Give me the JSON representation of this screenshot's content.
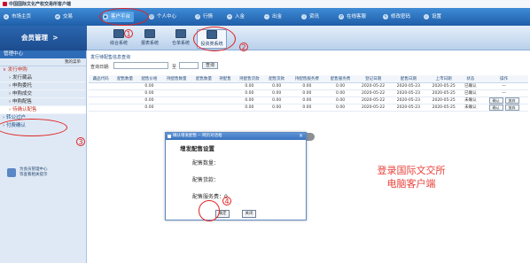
{
  "window": {
    "title": "中国国际文化产权交易所客户端"
  },
  "nav": {
    "items": [
      {
        "label": "市场主页",
        "icon": "home-icon"
      },
      {
        "label": "交易",
        "icon": "trade-icon"
      },
      {
        "label": "客户平台",
        "icon": "platform-icon",
        "active": true
      },
      {
        "label": "个人中心",
        "icon": "user-icon"
      },
      {
        "label": "行情",
        "icon": "market-icon"
      },
      {
        "label": "入金",
        "icon": "deposit-icon"
      },
      {
        "label": "出金",
        "icon": "withdraw-icon"
      },
      {
        "label": "资讯",
        "icon": "info-icon"
      },
      {
        "label": "在线客服",
        "icon": "service-icon"
      },
      {
        "label": "修改密码",
        "icon": "password-icon"
      },
      {
        "label": "设置",
        "icon": "settings-icon"
      }
    ]
  },
  "subheader": {
    "member_title": "会员管理",
    "systems": [
      {
        "label": "综合系统"
      },
      {
        "label": "报表系统"
      },
      {
        "label": "仓单系统"
      },
      {
        "label": "投资类系统",
        "active": true
      }
    ]
  },
  "sidebar": {
    "header": "管理中心",
    "sub": "我的菜单",
    "categories": [
      {
        "label": "发行申购",
        "items": [
          "发行藏品",
          "申购委托",
          "申购成交",
          "申购配售",
          "待确认配售"
        ]
      },
      {
        "label": "转公过户",
        "items": []
      },
      {
        "label": "付费确认",
        "items": []
      }
    ],
    "footer_line1": "为会员管理中心",
    "footer_line2": "等查看相关提示"
  },
  "main": {
    "breadcrumb": "发行待配售信息查询",
    "filter_label": "查询日期:",
    "to_label": "至",
    "query_button": "查询",
    "columns": [
      "藏品代码",
      "配售数量",
      "配售价格",
      "持配售数量",
      "配售数量",
      "持配售",
      "持配售货款",
      "配售货款",
      "持配售服务费",
      "配售服务费",
      "登记日期",
      "配售日期",
      "上市日期",
      "状态",
      "操作"
    ],
    "rows": [
      [
        "",
        "",
        "0.00",
        "",
        "",
        "",
        "0.00",
        "0.00",
        "0.00",
        "0.00",
        "2020-05-22",
        "2020-05-23",
        "2020-05-25",
        "已确认",
        "—"
      ],
      [
        "",
        "",
        "0.00",
        "",
        "",
        "",
        "0.00",
        "0.00",
        "0.00",
        "0.00",
        "2020-05-22",
        "2020-05-23",
        "2020-05-25",
        "已确认",
        "—"
      ],
      [
        "",
        "",
        "0.00",
        "",
        "",
        "",
        "0.00",
        "0.00",
        "0.00",
        "0.00",
        "2020-05-22",
        "2020-05-23",
        "2020-05-25",
        "未确认",
        "actions"
      ],
      [
        "",
        "",
        "0.00",
        "",
        "",
        "",
        "0.00",
        "0.00",
        "0.00",
        "0.00",
        "2020-05-22",
        "2020-05-23",
        "2020-05-25",
        "未确认",
        "actions"
      ]
    ],
    "row_actions": [
      "确认",
      "放弃"
    ]
  },
  "dialog": {
    "title": "确认增发配售 -- 网页对话框",
    "heading": "增发配售设置",
    "field1": "配售数量：",
    "field2": "配售货款：",
    "field3_label": "配售服务费：",
    "field3_value": "0",
    "ok": "确定",
    "close": "关闭"
  },
  "float_tag": "操作",
  "promo": {
    "line1": "登录国际文交所",
    "line2": "电脑客户端"
  },
  "annotations": [
    "1",
    "2",
    "3",
    "4"
  ],
  "colors": {
    "nav_bg": "#1f5ea8",
    "annotation": "#e02222",
    "promo": "#e8413a"
  }
}
